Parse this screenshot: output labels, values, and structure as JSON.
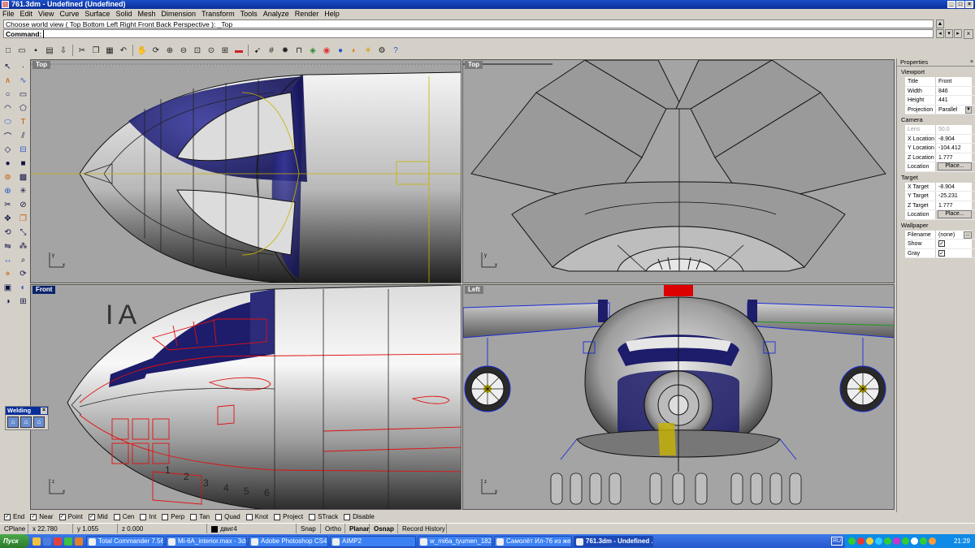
{
  "window": {
    "title": "761.3dm - Undefined (Undefined)"
  },
  "menu": [
    "File",
    "Edit",
    "View",
    "Curve",
    "Surface",
    "Solid",
    "Mesh",
    "Dimension",
    "Transform",
    "Tools",
    "Analyze",
    "Render",
    "Help"
  ],
  "command": {
    "history": "Choose world view ( Top  Bottom  Left  Right  Front  Back  Perspective ): _Top",
    "prompt": "Command:"
  },
  "toolbar_icons": [
    "new-icon",
    "open-icon",
    "save-icon",
    "print-icon",
    "import-icon",
    "cut-icon",
    "copy-icon",
    "paste-icon",
    "undo-icon",
    "pan-icon",
    "rotate-view-icon",
    "zoom-window-icon",
    "zoom-dynamic-icon",
    "zoom-extents-icon",
    "zoom-selected-icon",
    "four-viewports-icon",
    "car-icon",
    "select-icon",
    "grid-icon",
    "light-icon",
    "lock-icon",
    "layer-icon",
    "color-wheel-icon",
    "shaded-icon",
    "render-icon",
    "sun-icon",
    "gear-icon",
    "help-icon"
  ],
  "welding": {
    "title": "Welding"
  },
  "viewports": {
    "top": {
      "label": "Top"
    },
    "top_right": {
      "label": "Top"
    },
    "front": {
      "label": "Front",
      "marking": "IA",
      "digits": [
        "1",
        "2",
        "3",
        "4",
        "5",
        "6"
      ]
    },
    "left": {
      "label": "Left"
    }
  },
  "properties": {
    "title": "Properties",
    "viewport_section": "Viewport",
    "title_label": "Title",
    "title_value": "Front",
    "width_label": "Width",
    "width_value": "846",
    "height_label": "Height",
    "height_value": "441",
    "projection_label": "Projection",
    "projection_value": "Parallel",
    "camera_section": "Camera",
    "lens_label": "Lens Len...",
    "lens_value": "50.0",
    "xloc_label": "X Location",
    "xloc_value": "-8.904",
    "yloc_label": "Y Location",
    "yloc_value": "-104.412",
    "zloc_label": "Z Location",
    "zloc_value": "1.777",
    "location_label": "Location",
    "place_label": "Place...",
    "target_section": "Target",
    "xtarget_label": "X Target",
    "xtarget_value": "-8.904",
    "ytarget_label": "Y Target",
    "ytarget_value": "-25.231",
    "ztarget_label": "Z Target",
    "ztarget_value": "1.777",
    "tlocation_label": "Location",
    "tplace_label": "Place...",
    "wallpaper_section": "Wallpaper",
    "filename_label": "Filename",
    "filename_value": "(none)",
    "browse_label": "...",
    "show_label": "Show",
    "gray_label": "Gray"
  },
  "osnap": [
    {
      "label": "End",
      "checked": true
    },
    {
      "label": "Near",
      "checked": true
    },
    {
      "label": "Point",
      "checked": true
    },
    {
      "label": "Mid",
      "checked": true
    },
    {
      "label": "Cen",
      "checked": false
    },
    {
      "label": "Int",
      "checked": false
    },
    {
      "label": "Perp",
      "checked": false
    },
    {
      "label": "Tan",
      "checked": false
    },
    {
      "label": "Quad",
      "checked": false
    },
    {
      "label": "Knot",
      "checked": false
    },
    {
      "label": "Project",
      "checked": false
    },
    {
      "label": "STrack",
      "checked": false
    },
    {
      "label": "Disable",
      "checked": false
    }
  ],
  "status": {
    "cplane": "CPlane",
    "x": "x 22.780",
    "y": "y 1.055",
    "z": "z 0.000",
    "layer": "двиг4",
    "snap": "Snap",
    "ortho": "Ortho",
    "planar": "Planar",
    "osnap": "Osnap",
    "record": "Record History"
  },
  "taskbar": {
    "start": "Пуск",
    "tasks": [
      "Total Commander 7.56a ...",
      "Mi-6A_interior.max - 3ds...",
      "Adobe Photoshop CS4 E...",
      "AIMP2",
      "w_mi6a_tyumen_182.jp...",
      "Самолёт Ил-76 из жест...",
      "761.3dm - Undefined ..."
    ],
    "lang": "RU",
    "time": "21:29"
  },
  "colors": {
    "accent": "#0a246a",
    "navy": "#1d1d6b",
    "curve_red": "#e01010",
    "curve_blue": "#1a2bd8",
    "curve_yellow": "#c8b400"
  }
}
